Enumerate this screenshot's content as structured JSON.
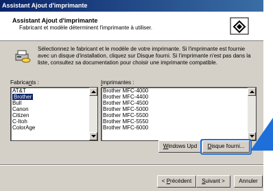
{
  "window": {
    "title": "Assistant Ajout d'imprimante"
  },
  "header": {
    "title": "Assistant Ajout d'imprimante",
    "subtitle": "Fabricant et modèle déterminent l'imprimante à utiliser.",
    "icon": "printer-wizard-icon"
  },
  "description": {
    "icon": "printer-disk-icon",
    "text": "Sélectionnez le fabricant et le modèle de votre imprimante. Si l'imprimante est fournie avec un disque d'installation, cliquez sur Disque fourni. Si l'imprimante n'est pas dans la liste, consultez sa documentation pour choisir une imprimante compatible."
  },
  "manufacturers": {
    "label_pre": "Fabrica",
    "label_accel": "n",
    "label_post": "ts :",
    "items": [
      "AT&T",
      "Brother",
      "Bull",
      "Canon",
      "Citizen",
      "C-Itoh",
      "ColorAge"
    ],
    "selected": "Brother"
  },
  "printers": {
    "label_accel": "I",
    "label_post": "mprimantes :",
    "items": [
      "Brother MFC-4000",
      "Brother MFC-4400",
      "Brother MFC-4500",
      "Brother MFC-5000",
      "Brother MFC-5500",
      "Brother MFC-5550",
      "Brother MFC-6000"
    ]
  },
  "buttons": {
    "windows_update": {
      "accel": "W",
      "rest": "indows Upd"
    },
    "have_disk": {
      "accel": "D",
      "rest": "isque fourni..."
    },
    "back": {
      "pre": "< ",
      "accel": "P",
      "rest": "récédent"
    },
    "next": {
      "accel": "S",
      "rest": "uivant >"
    },
    "cancel": "Annuler"
  },
  "colors": {
    "accent_highlight": "#1e6fd9",
    "titlebar": "#0a246a",
    "selection": "#0a246a"
  }
}
